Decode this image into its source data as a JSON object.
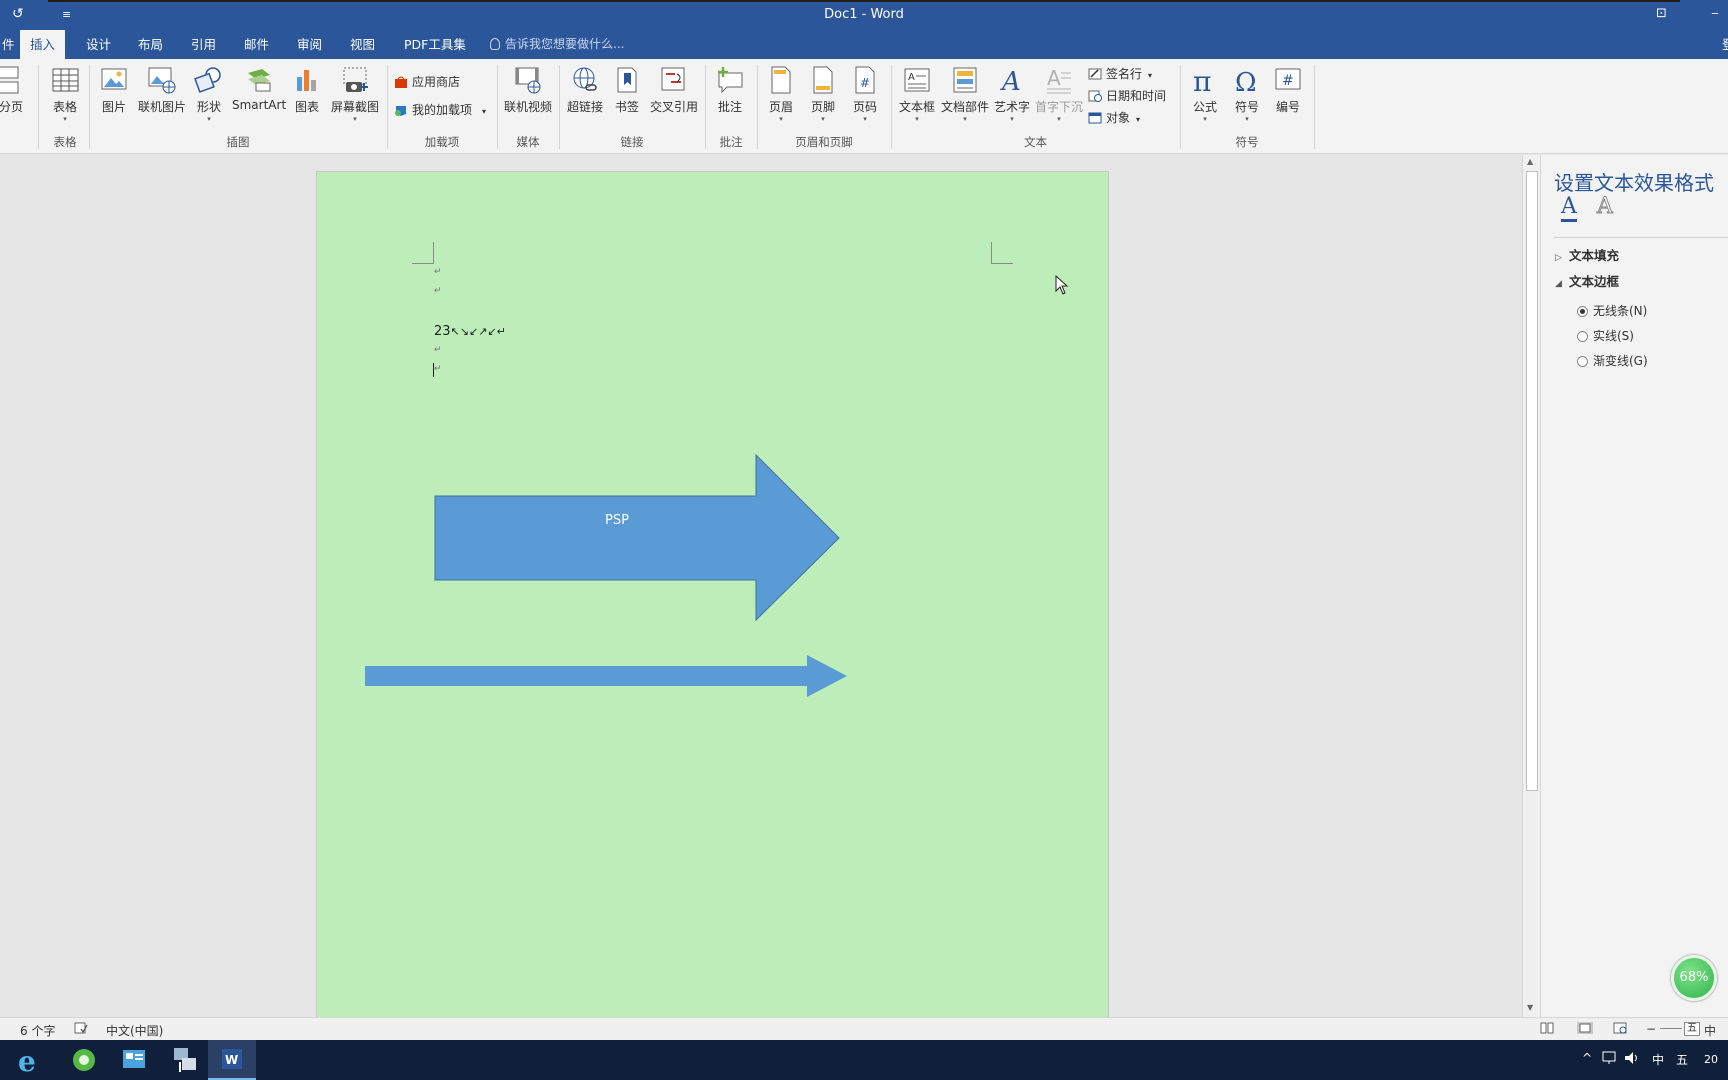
{
  "window": {
    "title": "Doc1 - Word",
    "undo_icon": "refresh-icon",
    "customize_icon": "≡",
    "restore_label": "⊡",
    "close_label": "✕",
    "signin_label": "登"
  },
  "tabs": [
    {
      "label": "件"
    },
    {
      "label": "插入",
      "active": true
    },
    {
      "label": "设计"
    },
    {
      "label": "布局"
    },
    {
      "label": "引用"
    },
    {
      "label": "邮件"
    },
    {
      "label": "审阅"
    },
    {
      "label": "视图"
    },
    {
      "label": "PDF工具集"
    }
  ],
  "tell_me": "告诉我您想要做什么...",
  "ribbon": {
    "groups": {
      "table": "表格",
      "illustrations": "插图",
      "addins": "加载项",
      "media": "媒体",
      "links": "链接",
      "comments": "批注",
      "header_footer": "页眉和页脚",
      "text": "文本",
      "symbols": "符号"
    },
    "buttons": {
      "page_break": "分页",
      "table": "表格",
      "picture": "图片",
      "online_picture": "联机图片",
      "shapes": "形状",
      "smartart": "SmartArt",
      "chart": "图表",
      "screenshot": "屏幕截图",
      "store": "应用商店",
      "my_addins": "我的加载项",
      "online_video": "联机视频",
      "hyperlink": "超链接",
      "bookmark": "书签",
      "cross_reference": "交叉引用",
      "comment": "批注",
      "header": "页眉",
      "footer": "页脚",
      "page_number": "页码",
      "text_box": "文本框",
      "quick_parts": "文档部件",
      "wordart": "艺术字",
      "drop_cap": "首字下沉",
      "signature_line": "签名行",
      "date_time": "日期和时间",
      "object": "对象",
      "equation": "公式",
      "symbol": "符号",
      "numbering": "编号"
    }
  },
  "document": {
    "para_mark": "↵",
    "line_text": "23",
    "arrows_text": "↖↘↙↗↙↵",
    "shape_label": "PSP",
    "colors": {
      "page": "#bdedb9",
      "arrow_fill": "#5b9bd5",
      "arrow_stroke": "#41719c"
    }
  },
  "pane": {
    "title": "设置文本效果格式",
    "fill_icon_letter": "A",
    "effects_icon_letter": "A",
    "sections": {
      "text_fill": "文本填充",
      "text_outline": "文本边框"
    },
    "options": [
      {
        "label": "无线条(N)",
        "selected": true
      },
      {
        "label": "实线(S)",
        "selected": false
      },
      {
        "label": "渐变线(G)",
        "selected": false
      }
    ]
  },
  "status": {
    "word_count": "6 个字",
    "language": "中文(中国)",
    "zoom_minus": "−",
    "ime_mode": "中",
    "ime_icon": "五"
  },
  "badge": {
    "percent": "68%"
  },
  "taskbar": {
    "tray_ime": "中",
    "tray_wubi": "五",
    "clock": "20"
  },
  "colors": {
    "brand": "#2b579a",
    "taskbar": "#11203a"
  }
}
